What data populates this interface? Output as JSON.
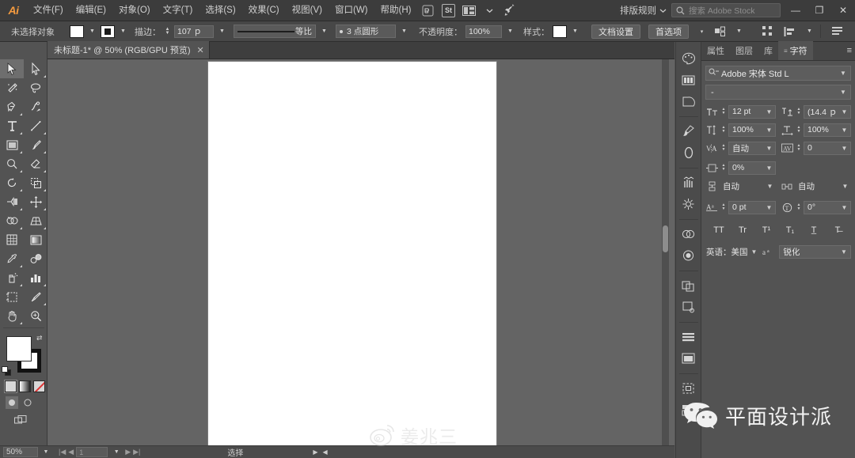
{
  "app": {
    "name": "Adobe Illustrator",
    "logo_text": "Ai"
  },
  "menubar": {
    "items": [
      {
        "label": "文件(F)"
      },
      {
        "label": "编辑(E)"
      },
      {
        "label": "对象(O)"
      },
      {
        "label": "文字(T)"
      },
      {
        "label": "选择(S)"
      },
      {
        "label": "效果(C)"
      },
      {
        "label": "视图(V)"
      },
      {
        "label": "窗口(W)"
      },
      {
        "label": "帮助(H)"
      }
    ],
    "bridge_label": "Br",
    "stock_label": "St",
    "arrange_label": "排版规则",
    "search_placeholder": "搜索 Adobe Stock",
    "minimize": "—",
    "restore": "❐",
    "close": "✕"
  },
  "optionsbar": {
    "selection_status": "未选择对象",
    "fill_color": "#ffffff",
    "stroke_color": "#1b1b1b",
    "stroke_label": "描边：",
    "stroke_weight": "107 ｐ",
    "stroke_profile": "等比",
    "brush_definition": "3 点圆形",
    "opacity_label": "不透明度：",
    "opacity_value": "100%",
    "style_label": "样式：",
    "doc_setup_button": "文档设置",
    "preferences_button": "首选项"
  },
  "tabbar": {
    "document_title": "未标题-1* @ 50% (RGB/GPU 预览)",
    "close_glyph": "✕"
  },
  "toolbar": {
    "tools": [
      {
        "name": "selection-tool",
        "active": true
      },
      {
        "name": "direct-selection-tool",
        "active": false
      },
      {
        "name": "magic-wand-tool",
        "active": false
      },
      {
        "name": "lasso-tool",
        "active": false
      },
      {
        "name": "pen-tool",
        "active": false
      },
      {
        "name": "curvature-tool",
        "active": false
      },
      {
        "name": "type-tool",
        "active": false
      },
      {
        "name": "line-segment-tool",
        "active": false
      },
      {
        "name": "rectangle-tool",
        "active": false
      },
      {
        "name": "paintbrush-tool",
        "active": false
      },
      {
        "name": "shaper-tool",
        "active": false
      },
      {
        "name": "eraser-tool",
        "active": false
      },
      {
        "name": "rotate-tool",
        "active": false
      },
      {
        "name": "scale-tool",
        "active": false
      },
      {
        "name": "width-tool",
        "active": false
      },
      {
        "name": "free-transform-tool",
        "active": false
      },
      {
        "name": "shape-builder-tool",
        "active": false
      },
      {
        "name": "perspective-grid-tool",
        "active": false
      },
      {
        "name": "mesh-tool",
        "active": false
      },
      {
        "name": "gradient-tool",
        "active": false
      },
      {
        "name": "eyedropper-tool",
        "active": false
      },
      {
        "name": "blend-tool",
        "active": false
      },
      {
        "name": "symbol-sprayer-tool",
        "active": false
      },
      {
        "name": "column-graph-tool",
        "active": false
      },
      {
        "name": "artboard-tool",
        "active": false
      },
      {
        "name": "slice-tool",
        "active": false
      },
      {
        "name": "hand-tool",
        "active": false
      },
      {
        "name": "zoom-tool",
        "active": false
      }
    ],
    "fill_color": "#ffffff",
    "stroke_color": "#121212",
    "draw_modes": [
      {
        "name": "draw-normal",
        "active": true
      },
      {
        "name": "draw-behind",
        "active": false
      },
      {
        "name": "draw-inside",
        "active": false
      }
    ],
    "screen_modes": [
      {
        "name": "normal-screen-mode",
        "active": true
      },
      {
        "name": "full-screen-mode",
        "active": false
      }
    ]
  },
  "canvas": {
    "artboard_color": "#ffffff",
    "background_color": "#646464"
  },
  "statusbar": {
    "zoom_value": "50%",
    "artboard_nav_first": "|◀",
    "artboard_nav_prev": "◀",
    "artboard_number": "1",
    "artboard_nav_next": "▶",
    "artboard_nav_last": "▶|",
    "current_tool": "选择",
    "play_glyph": "▶",
    "left_glyph": "◀"
  },
  "dock": {
    "icons": [
      {
        "name": "color-panel-icon"
      },
      {
        "name": "color-guide-panel-icon"
      },
      {
        "name": "swatches-panel-icon"
      },
      {
        "name": "brushes-panel-icon"
      },
      {
        "name": "symbols-panel-icon"
      },
      {
        "name": "stroke-panel-icon"
      },
      {
        "name": "gradient-panel-icon"
      },
      {
        "name": "transparency-panel-icon"
      },
      {
        "name": "appearance-panel-icon"
      },
      {
        "name": "pathfinder-panel-icon"
      },
      {
        "name": "align-panel-icon"
      },
      {
        "name": "transform-panel-icon"
      },
      {
        "name": "artboards-panel-icon"
      },
      {
        "name": "asset-export-panel-icon"
      },
      {
        "name": "libraries-panel-icon"
      }
    ]
  },
  "panel": {
    "tabs": [
      {
        "label": "属性",
        "active": false
      },
      {
        "label": "图层",
        "active": false
      },
      {
        "label": "库",
        "active": false
      },
      {
        "label": "字符",
        "active": true
      }
    ],
    "menu_glyph": "≡",
    "character": {
      "font_family": "Adobe 宋体 Std L",
      "font_style": "-",
      "font_size_icon": "size-icon",
      "font_size": "12 pt",
      "leading_icon": "leading-icon",
      "leading": "(14.4 ｐ",
      "vertical_scale_icon": "vertical-scale-icon",
      "vertical_scale": "100%",
      "horizontal_scale_icon": "horizontal-scale-icon",
      "horizontal_scale": "100%",
      "kerning_icon": "kerning-icon",
      "kerning": "自动",
      "tracking_icon": "tracking-icon",
      "tracking": "0",
      "tsume_icon": "tsume-icon",
      "tsume": "0%",
      "vertical_gap_icon": "vertical-gap-icon",
      "vertical_gap": "自动",
      "horizontal_gap_icon": "horizontal-gap-icon",
      "horizontal_gap": "自动",
      "baseline_shift_icon": "baseline-shift-icon",
      "baseline_shift": "0 pt",
      "rotation_icon": "character-rotation-icon",
      "rotation": "0°",
      "style_buttons": [
        {
          "name": "all-caps-button",
          "label": "TT"
        },
        {
          "name": "small-caps-button",
          "label": "Tr"
        },
        {
          "name": "superscript-button",
          "label": "T¹"
        },
        {
          "name": "subscript-button",
          "label": "T₁"
        },
        {
          "name": "underline-button",
          "label": "T̲"
        },
        {
          "name": "strikethrough-button",
          "label": "T̶"
        }
      ],
      "language_label": "英语：美国",
      "antialias_icon": "antialias-icon",
      "antialias_value": "锐化"
    }
  },
  "watermarks": {
    "wechat_label": "平面设计派",
    "weibo_label": "姜兆三"
  }
}
